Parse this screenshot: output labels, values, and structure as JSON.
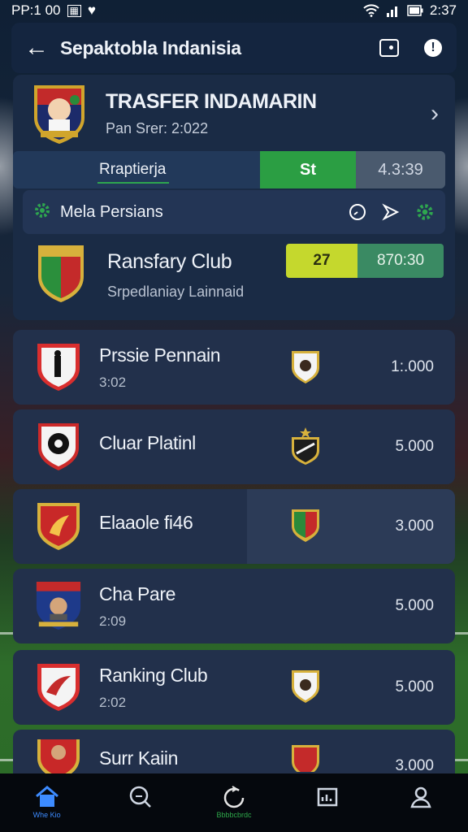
{
  "status_bar": {
    "left_text": "PP:1 00",
    "time": "2:37"
  },
  "header": {
    "title": "Sepaktobla Indanisia",
    "back_icon": "arrow-left-icon",
    "action_icons": [
      "square-icon",
      "info-icon"
    ]
  },
  "transfer": {
    "title": "TRASFER INDAMARIN",
    "subtitle": "Pan Srer: 2:022"
  },
  "tabs": {
    "label": "Rraptierja",
    "green_value": "St",
    "grey_value": "4.3:39"
  },
  "filter": {
    "label": "Mela Persians"
  },
  "highlight_club": {
    "name": "Ransfary Club",
    "subtitle": "Srpedlaniay Lainnaid",
    "yellow_value": "27",
    "green_value": "870:30"
  },
  "list": [
    {
      "name": "Prssie Pennain",
      "sub": "3:02",
      "value": "1:.000"
    },
    {
      "name": "Cluar Platinl",
      "sub": "",
      "value": "5.000"
    },
    {
      "name": "Elaaole fi46",
      "sub": "",
      "value": "3.000"
    },
    {
      "name": "Cha Pare",
      "sub": "2:09",
      "value": "5.000"
    },
    {
      "name": "Ranking Club",
      "sub": "2:02",
      "value": "5.000"
    },
    {
      "name": "Surr Kaiin",
      "sub": "",
      "value": "3.000"
    }
  ],
  "bottom_nav": [
    {
      "icon": "home-icon",
      "label": "Whe Kio",
      "color": "#3d8bff"
    },
    {
      "icon": "search-chat-icon",
      "label": ""
    },
    {
      "icon": "refresh-icon",
      "label": "Bbbbcbrdc",
      "color": "#2ea84a"
    },
    {
      "icon": "stats-icon",
      "label": ""
    },
    {
      "icon": "user-icon",
      "label": ""
    }
  ],
  "colors": {
    "accent_green": "#2b9e43",
    "accent_yellow": "#c5d82d",
    "panel": "#1a2b45"
  }
}
